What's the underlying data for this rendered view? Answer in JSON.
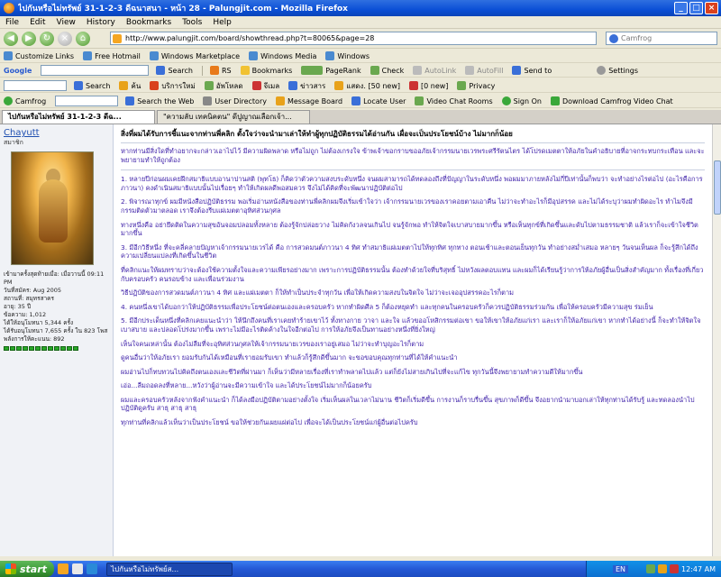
{
  "window": {
    "title": "ไปกันหรือไม่ทรัพย์ 31-1-2-3 ดีฉนาสนา - หน้า 28 - Palungjit.com - Mozilla Firefox"
  },
  "menu": [
    "File",
    "Edit",
    "View",
    "History",
    "Bookmarks",
    "Tools",
    "Help"
  ],
  "nav": {
    "url": "http://www.palungjit.com/board/showthread.php?t=80065&page=28",
    "search_placeholder": "Camfrog"
  },
  "bookmarks": [
    "Customize Links",
    "Free Hotmail",
    "Windows Marketplace",
    "Windows Media",
    "Windows"
  ],
  "google_toolbar": [
    "Google",
    "Search",
    "RS",
    "Bookmarks",
    "PageRank",
    "Check",
    "AutoLink",
    "AutoFill",
    "Send to",
    "Settings"
  ],
  "toolbar3": [
    "Search",
    "ค้น",
    "บริการใหม่",
    "อัพโหลด",
    "จีเมล",
    "ข่าวสาร",
    "แสดง. [50 new]",
    "[0 new]",
    "Privacy"
  ],
  "camfrog_toolbar": [
    "Camfrog",
    "Search the Web",
    "User Directory",
    "Message Board",
    "Locate User",
    "Video Chat Rooms",
    "Sign On",
    "Download Camfrog Video Chat"
  ],
  "tabs": [
    {
      "label": "ไปกันหรือไม่ทรัพย์ 31-1-2-3 ดีฉ...",
      "active": true
    },
    {
      "label": "\"ความลับ เทคนิคตน\" ดีปูญาณเลือกเจ้า...",
      "active": false
    }
  ],
  "user": {
    "name": "Chayutt",
    "title": "สมาชิก",
    "info": [
      "เข้ามาครั้งสุดท้ายเมื่อ: เมื่อวานนี้ 09:11 PM",
      "วันที่สมัคร: Aug 2005",
      "สถานที่: สมุทรสาคร",
      "อายุ: 35 ปี",
      "ข้อความ: 1,012",
      "ได้ให้อนุโมทนา 5,344 ครั้ง",
      "ได้รับอนุโมทนา 7,655 ครั้ง ใน 823 โพส",
      "พลังการให้คะแนน: 892"
    ],
    "reputation_bars": 12
  },
  "post": {
    "title": "สิ่งที่ผมได้รับการชี้แนะจากท่านพี่คลิก ตั้งใจว่าจะนำมาเล่าให้ทำผู้ทุกปฏิบัติธรรมได้อ่านกัน เผื่อจะเป็นประโยชน์บ้าง ไม่มากก็น้อย",
    "paragraphs": [
      "หากท่านมีสิ่งใดที่ทำอยากจะกล่าวเอาไปไว้ มีความผิดพลาด หรือไม่ถูก ไม่ต้องเกรงใจ ข้าพเจ้าขอกราบขออภัยเจ้ากรรมนายเวรพระศรีรัตนไตร ได้โปรดเมตตาให้อภัยในคำอธิบายที่อาจกระทบกระเทือน และจะพยายามทำให้ถูกต้อง",
      "1. หลายปีก่อนผมเคยฝึกสมาธิแบบอานาปานสติ (พุทโธ) ก็คิดว่าตัวความสงบระดับหนึ่ง จนผมสามารถได้ทดลองถึงที่ปัญญาในระดับหนึ่ง พอผมมาภายหลังไม่กี่ปีเท่านั้นก็พบว่า จะทำอย่างไรต่อไป (อะไรคือการภาวนา) คงดำเนินสมาธิแบบนั้นไปเรื่อยๆ ทำให้เกิดผลดีพอสมควร จึงไม่ได้คิดที่จะพัฒนาปฏิบัติต่อไป",
      "2. พิจารณาทุกข์ ผมมีหนังสือปฏิบัติธรรม พอเริ่มอ่านหนังสือของท่านพี่คลิกผมจึงเริ่มเข้าใจว่า เจ้ากรรมนายเวรของเราคอยตามเอาคืน ไม่ว่าจะทำอะไรก็มีอุปสรรค และไม่ได้ระบุว่าผมทำผิดอะไร ทำไมจึงมีกรรมติดตัวมาตลอด เราจึงต้องรีบแผ่เมตตาอุทิศส่วนกุศล",
      "ทางหนึ่งคือ อย่ายึดติดในความสุขอันจอมปลอมทั้งหลาย ต้องรู้จักปล่อยวาง ไม่คิดกังวลจนเกินไป จนรู้จักพอ ทำให้จิตใจเบาสบายมากขึ้น หรือเห็นทุกข์ที่เกิดขึ้นและดับไปตามธรรมชาติ แล้วเราก็จะเข้าใจชีวิตมากขึ้น",
      "3. มีอีกวิธีหนึ่ง ที่จะคลี่คลายปัญหาเจ้ากรรมนายเวรได้ คือ การสวดมนต์ภาวนา 4 ทิศ ทำสมาธิแผ่เมตตาไปให้ทุกทิศ ทุกทาง ตอนเช้าและตอนเย็นทุกวัน ทำอย่างสม่ำเสมอ หลายๆ วันจนเห็นผล ก็จะรู้สึกได้ถึงความเปลี่ยนแปลงที่เกิดขึ้นในชีวิต",
      "ที่คลิกแนะให้ผมทราบว่าจะต้องใช้ความตั้งใจและความเพียรอย่างมาก เพราะการปฏิบัติธรรมนั้น ต้องทำด้วยใจที่บริสุทธิ์ ไม่หวังผลตอบแทน และผมก็ได้เรียนรู้ว่าการให้อภัยผู้อื่นเป็นสิ่งสำคัญมาก ทั้งเรื่องที่เกี่ยวกับครอบครัว คนรอบข้าง และเพื่อนร่วมงาน",
      "วิธีปฏิบัติของการสวดมนต์ภาวนา 4 ทิศ และแผ่เมตตา ก็ให้ทำเป็นประจำทุกวัน เพื่อให้เกิดความสงบในจิตใจ ไม่ว่าจะเจออุปสรรคอะไรก็ตาม",
      "4. คนหนึ่งเขาได้บอกว่าให้ปฏิบัติธรรมเพื่อประโยชน์ต่อตนเองและครอบครัว หากทำผิดศีล 5 ก็ต้องหยุดทำ และทุกคนในครอบครัวก็ควรปฏิบัติธรรมร่วมกัน เพื่อให้ครอบครัวมีความสุข ร่มเย็น",
      "5. มีอีกประเด็นหนึ่งที่คลิกเคยแนะนำว่า ให้นึกถึงคนที่เราเคยทำร้ายเขาไว้ ทั้งทางกาย วาจา และใจ แล้วขออโหสิกรรมต่อเขา ขอให้เขาให้อภัยแก่เรา และเราก็ให้อภัยแก่เขา หากทำได้อย่างนี้ ก็จะทำให้จิตใจเบาสบาย และปลอดโปร่งมากขึ้น เพราะไม่มีอะไรติดค้างในใจอีกต่อไป การให้อภัยจึงเป็นทานอย่างหนึ่งที่ยิ่งใหญ่",
      "เห็นใจคนเหล่านั้น ต้องไม่ลืมที่จะอุทิศส่วนกุศลให้เจ้ากรรมนายเวรของเราอยู่เสมอ ไม่ว่าจะทำบุญอะไรก็ตาม",
      "ดูคนอื่นว่าให้อภัยเรา ยอมรับกันได้เหมือนที่เรายอมรับเขา ทำแล้วก็รู้สึกดีขึ้นมาก จะขอขอบคุณทุกท่านที่ได้ให้คำแนะนำ",
      "ผมอ่านไปก็ทบทวนไปคิดถึงตนเองและชีวิตที่ผ่านมา ก็เห็นว่ามีหลายเรื่องที่เราทำพลาดไปแล้ว แต่ก็ยังไม่สายเกินไปที่จะแก้ไข ทุกวันนี้จึงพยายามทำความดีให้มากขึ้น",
      "เอ่อ...ลืมถอดลงที่หลาย...หวังว่าผู้อ่านจะมีความเข้าใจ และได้ประโยชน์ไม่มากก็น้อยครับ",
      "ผมและครอบครัวหลังจากฟังคำแนะนำ ก็ได้ลงมือปฏิบัติตามอย่างตั้งใจ เริ่มเห็นผลในเวลาไม่นาน ชีวิตก็เริ่มดีขึ้น การงานก็ราบรื่นขึ้น สุขภาพก็ดีขึ้น จึงอยากนำมาบอกเล่าให้ทุกท่านได้รับรู้ และทดลองนำไปปฏิบัติดูครับ สาธุ สาธุ สาธุ",
      "ทุกท่านที่คลิกแล้วเห็นว่าเป็นประโยชน์ ขอให้ช่วยกันเผยแผ่ต่อไป เพื่อจะได้เป็นประโยชน์แก่ผู้อื่นต่อไปครับ"
    ]
  },
  "taskbar": {
    "start": "start",
    "window_item": "ไปกันหรือไม่ทรัพย์ส...",
    "lang": "EN",
    "time": "12:47 AM"
  },
  "colors": {
    "post_text": "#3d1fa8",
    "title_bar": "#0b4fd6",
    "taskbar": "#2459d6"
  }
}
